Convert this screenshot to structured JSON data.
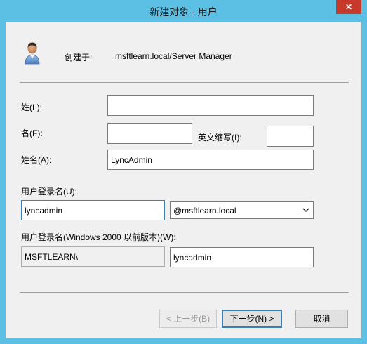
{
  "window": {
    "title": "新建对象 - 用户",
    "close_glyph": "✕"
  },
  "header": {
    "icon": "user-icon",
    "created_in_label": "创建于:",
    "created_in_value": "msftlearn.local/Server Manager"
  },
  "form": {
    "last_name_label": "姓(L):",
    "last_name_value": "",
    "first_name_label": "名(F):",
    "first_name_value": "",
    "initials_label": "英文缩写(I):",
    "initials_value": "",
    "full_name_label": "姓名(A):",
    "full_name_value": "LyncAdmin",
    "logon_name_label": "用户登录名(U):",
    "logon_name_value": "lyncadmin",
    "upn_suffix_selected": "@msftlearn.local",
    "pre2000_label": "用户登录名(Windows 2000 以前版本)(W):",
    "pre2000_domain_value": "MSFTLEARN\\",
    "pre2000_name_value": "lyncadmin"
  },
  "buttons": {
    "back_label": "< 上一步(B)",
    "next_label": "下一步(N) >",
    "cancel_label": "取消"
  },
  "colors": {
    "titlebar": "#5bc0e4",
    "close_button": "#c7392b",
    "client_background": "#f0f0f0",
    "focus_border": "#3c7fb1"
  }
}
